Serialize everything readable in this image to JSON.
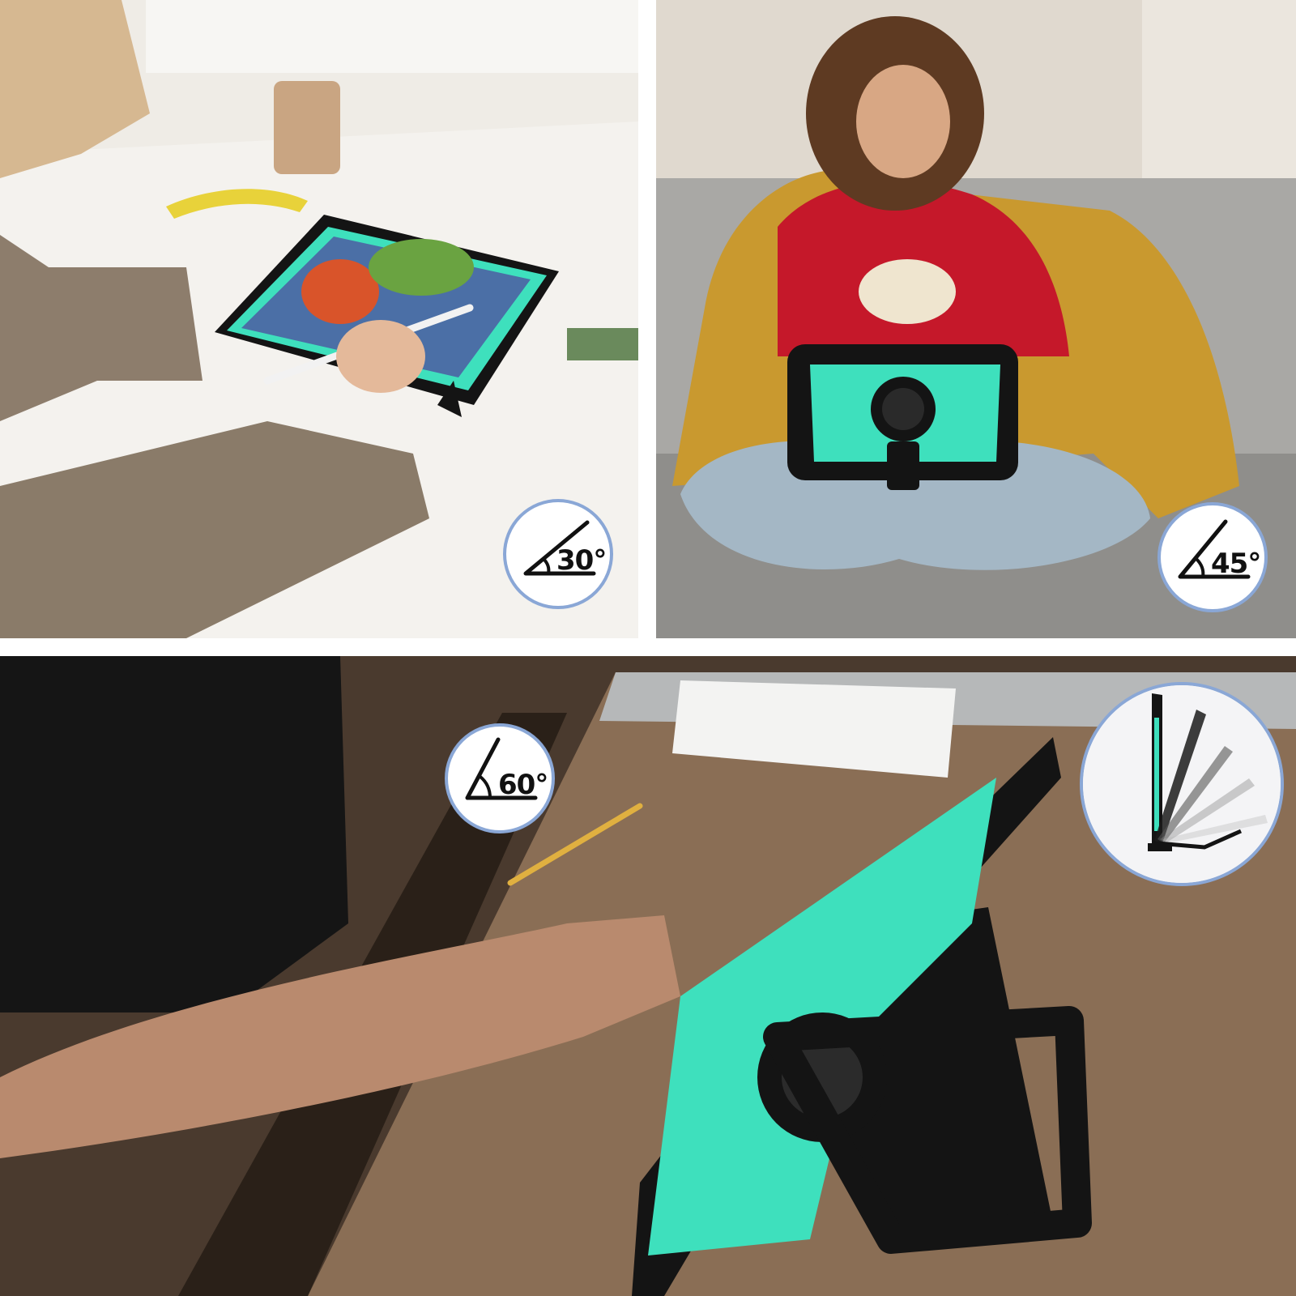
{
  "angle_badges": [
    {
      "id": "30",
      "label": "30°"
    },
    {
      "id": "45",
      "label": "45°"
    },
    {
      "id": "60",
      "label": "60°"
    }
  ],
  "colors": {
    "case_accent": "#3ee0bd",
    "case_black": "#141414",
    "badge_border": "#8aa7d6",
    "sweater_red": "#c5182a",
    "blanket_mustard": "#c9992f"
  }
}
